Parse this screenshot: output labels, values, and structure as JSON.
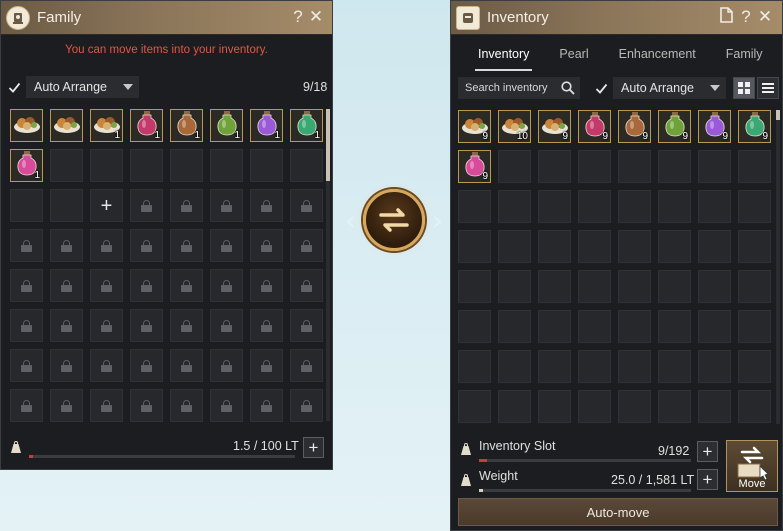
{
  "family": {
    "title": "Family",
    "help": "?",
    "close": "✕",
    "notice": "You can move items into your inventory.",
    "auto_arrange": "Auto Arrange",
    "slot_count": "9/18",
    "weight_text": "1.5 / 100 LT",
    "add_label": "+",
    "items": [
      {
        "icon": "food-platter-icon",
        "qty": ""
      },
      {
        "icon": "food-platter-icon",
        "qty": ""
      },
      {
        "icon": "food-platter-icon",
        "qty": "1"
      },
      {
        "icon": "red-potion-icon",
        "qty": "1"
      },
      {
        "icon": "brown-potion-icon",
        "qty": "1"
      },
      {
        "icon": "green-potion-icon",
        "qty": "1"
      },
      {
        "icon": "purple-potion-icon",
        "qty": "1"
      },
      {
        "icon": "teal-potion-icon",
        "qty": "1"
      },
      {
        "icon": "pink-potion-icon",
        "qty": "1"
      }
    ]
  },
  "inventory": {
    "title": "Inventory",
    "help": "?",
    "close": "✕",
    "tabs": [
      "Inventory",
      "Pearl",
      "Enhancement",
      "Family"
    ],
    "active_tab": "Inventory",
    "search_placeholder": "Search inventory",
    "auto_arrange": "Auto Arrange",
    "slot_label": "Inventory Slot",
    "slot_count": "9/192",
    "weight_label": "Weight",
    "weight_text": "25.0 / 1,581 LT",
    "add_label": "+",
    "move_label": "Move",
    "auto_move_label": "Auto-move",
    "items": [
      {
        "icon": "food-platter-icon",
        "qty": "9"
      },
      {
        "icon": "food-platter-icon",
        "qty": "10"
      },
      {
        "icon": "food-platter-icon",
        "qty": "9"
      },
      {
        "icon": "red-potion-icon",
        "qty": "9"
      },
      {
        "icon": "brown-potion-icon",
        "qty": "9"
      },
      {
        "icon": "green-potion-icon",
        "qty": "9"
      },
      {
        "icon": "purple-potion-icon",
        "qty": "9"
      },
      {
        "icon": "teal-potion-icon",
        "qty": "9"
      },
      {
        "icon": "pink-potion-icon",
        "qty": "9"
      }
    ]
  },
  "colors": {
    "notice": "#e05840",
    "item_border": "#b99a4a",
    "red-potion": "#c2396a",
    "brown-potion": "#a8683a",
    "green-potion": "#6fa33a",
    "purple-potion": "#9a5ad8",
    "teal-potion": "#3aa872",
    "pink-potion": "#d84a9a"
  },
  "swap": {
    "icon": "swap-arrows-icon"
  }
}
